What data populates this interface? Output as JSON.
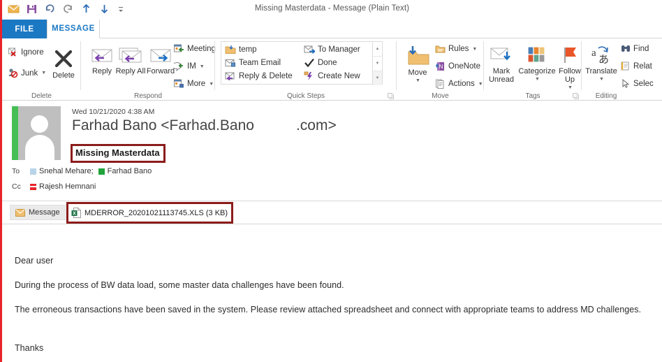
{
  "window": {
    "title": "Missing Masterdata - Message (Plain Text)"
  },
  "quick_access_toolbar": {
    "items": [
      {
        "name": "mail-icon",
        "label": "Mail"
      },
      {
        "name": "save-icon",
        "label": "Save"
      },
      {
        "name": "undo-icon",
        "label": "Undo"
      },
      {
        "name": "redo-icon",
        "label": "Redo"
      },
      {
        "name": "previous-item-icon",
        "label": "Previous Item"
      },
      {
        "name": "next-item-icon",
        "label": "Next Item"
      },
      {
        "name": "customize-toolbar-icon",
        "label": "Customize Quick Access Toolbar"
      }
    ]
  },
  "tabs": [
    {
      "id": "file",
      "label": "FILE",
      "active": false
    },
    {
      "id": "message",
      "label": "MESSAGE",
      "active": true
    }
  ],
  "ribbon": {
    "groups": [
      {
        "name": "delete",
        "label": "Delete",
        "items": [
          {
            "label": "Ignore",
            "type": "small"
          },
          {
            "label": "Junk",
            "type": "small",
            "caret": true
          },
          {
            "label": "Delete",
            "type": "big"
          }
        ]
      },
      {
        "name": "respond",
        "label": "Respond",
        "items": [
          {
            "label": "Reply",
            "type": "big"
          },
          {
            "label": "Reply All",
            "type": "big"
          },
          {
            "label": "Forward",
            "type": "big"
          },
          {
            "label": "Meeting",
            "type": "small"
          },
          {
            "label": "IM",
            "type": "small",
            "caret": true
          },
          {
            "label": "More",
            "type": "small",
            "caret": true
          }
        ]
      },
      {
        "name": "quick-steps",
        "label": "Quick Steps",
        "items": [
          {
            "label": "temp",
            "type": "gallery"
          },
          {
            "label": "Team Email",
            "type": "gallery"
          },
          {
            "label": "Reply & Delete",
            "type": "gallery"
          },
          {
            "label": "To Manager",
            "type": "gallery"
          },
          {
            "label": "Done",
            "type": "gallery"
          },
          {
            "label": "Create New",
            "type": "gallery"
          }
        ]
      },
      {
        "name": "move",
        "label": "Move",
        "items": [
          {
            "label": "Move",
            "type": "big",
            "caret": true
          },
          {
            "label": "Rules",
            "type": "small",
            "caret": true
          },
          {
            "label": "OneNote",
            "type": "small"
          },
          {
            "label": "Actions",
            "type": "small",
            "caret": true
          }
        ]
      },
      {
        "name": "tags",
        "label": "Tags",
        "items": [
          {
            "label": "Mark Unread",
            "type": "big"
          },
          {
            "label": "Categorize",
            "type": "big",
            "caret": true
          },
          {
            "label": "Follow Up",
            "type": "big",
            "caret": true
          }
        ]
      },
      {
        "name": "editing",
        "label": "Editing",
        "items": [
          {
            "label": "Translate",
            "type": "big",
            "caret": true
          },
          {
            "label": "Find",
            "type": "small"
          },
          {
            "label": "Relat",
            "type": "small"
          },
          {
            "label": "Selec",
            "type": "small"
          }
        ]
      }
    ]
  },
  "message": {
    "date": "Wed 10/21/2020 4:38 AM",
    "sender_prefix": "Farhad Bano <Farhad.Bano",
    "sender_suffix": ".com>",
    "subject": "Missing Masterdata",
    "to_label": "To",
    "cc_label": "Cc",
    "to": [
      {
        "name": "Snehal Mehare;",
        "presence": "#b9d4e8"
      },
      {
        "name": "Farhad Bano",
        "presence": "#21a33c"
      }
    ],
    "cc": [
      {
        "name": "Rajesh Hemnani",
        "presence": "#e8232a"
      }
    ],
    "message_tab_label": "Message",
    "attachment": {
      "name": "MDERROR_20201021113745.XLS (3 KB)"
    },
    "body": [
      "Dear user",
      "During the process of BW data load, some master data challenges have been found.",
      "The erroneous transactions have been saved in the system. Please review attached spreadsheet and connect with appropriate teams to address MD challenges.",
      "Thanks"
    ]
  },
  "colors": {
    "accent_blue": "#1b79c4",
    "annotation_red": "#8c1c1c",
    "left_strip_red": "#e8232a",
    "presence_green": "#45bf55"
  }
}
